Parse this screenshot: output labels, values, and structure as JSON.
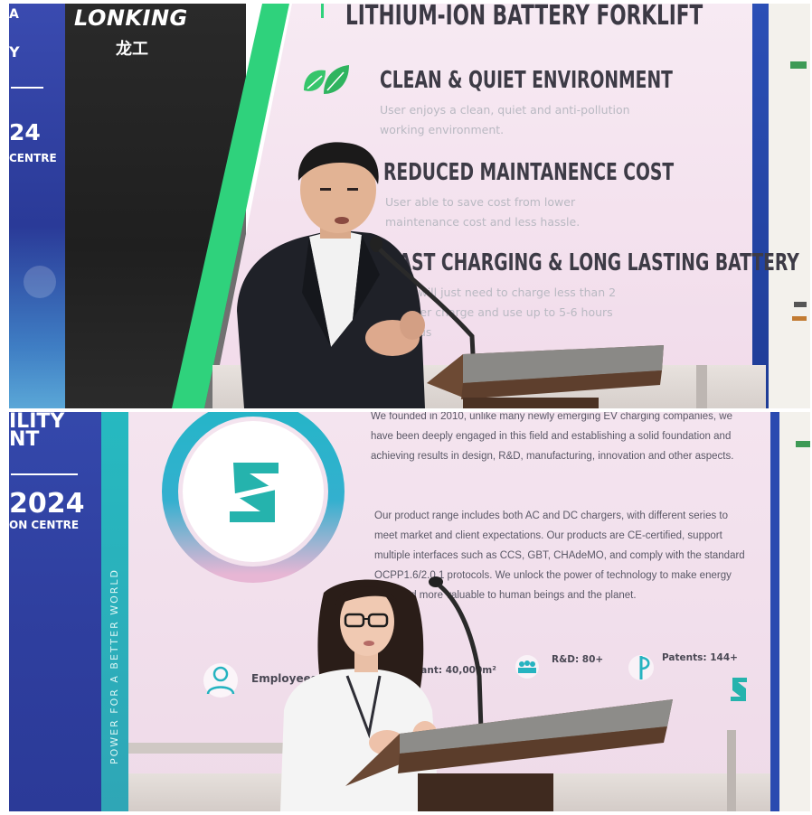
{
  "top_photo": {
    "backdrop": {
      "expo_fragment_1": "A",
      "expo_fragment_2": "Y",
      "expo_year_fragment": "24",
      "expo_venue_fragment": "CENTRE"
    },
    "brand": {
      "name": "LONKING",
      "name_cn": "龙工"
    },
    "slide": {
      "title": "LITHIUM-ION BATTERY FORKLIFT",
      "features": [
        {
          "heading": "CLEAN & QUIET ENVIRONMENT",
          "line1": "User enjoys a clean, quiet and anti-pollution",
          "line2": "working environment."
        },
        {
          "heading": "REDUCED MAINTANENCE COST",
          "line1": "User able to save cost from lower",
          "line2": "maintenance cost and less hassle."
        },
        {
          "heading": "FAST CHARGING & LONG LASTING BATTERY",
          "line1": "User will just need to charge less than 2",
          "line2": "s per charge and use up to 5-6 hours",
          "line3": "inuous"
        }
      ],
      "icon": "leaf-icon"
    }
  },
  "bottom_photo": {
    "backdrop": {
      "expo_line_1": "ILITY",
      "expo_line_2": "NT",
      "expo_year": "2024",
      "expo_venue": "ON CENTRE"
    },
    "slide": {
      "vertical_slogan": "POWER FOR A BETTER WORLD",
      "paragraph1": [
        "We founded in 2010, unlike many newly emerging EV charging companies, we",
        "have been deeply engaged in this field and establishing a solid foundation and",
        "achieving results in design, R&D, manufacturing, innovation and other aspects."
      ],
      "paragraph2": [
        "Our product range includes both AC and DC chargers, with different series to",
        "meet market and client expectations. Our products are CE-certified, support",
        "multiple interfaces such as CCS, GBT, CHAdeMO, and comply with the standard",
        "OCPP1.6/2.0.1 protocols. We unlock the power of technology to make energy",
        "er and more valuable to human beings and the planet."
      ],
      "stats": {
        "employees": "Employees",
        "plant": "Plant:  40,000m²",
        "rnd": "R&D:  80+",
        "patents": "Patents: 144+"
      },
      "logo_icon": "s-logo-icon",
      "stat_icons": [
        "person-icon",
        "team-icon",
        "patent-icon"
      ]
    }
  },
  "colors": {
    "slide_pink": "#f3e3ee",
    "accent_green": "#2fd27c",
    "teal": "#25b5ad",
    "expo_blue": "#2c3f9b"
  }
}
